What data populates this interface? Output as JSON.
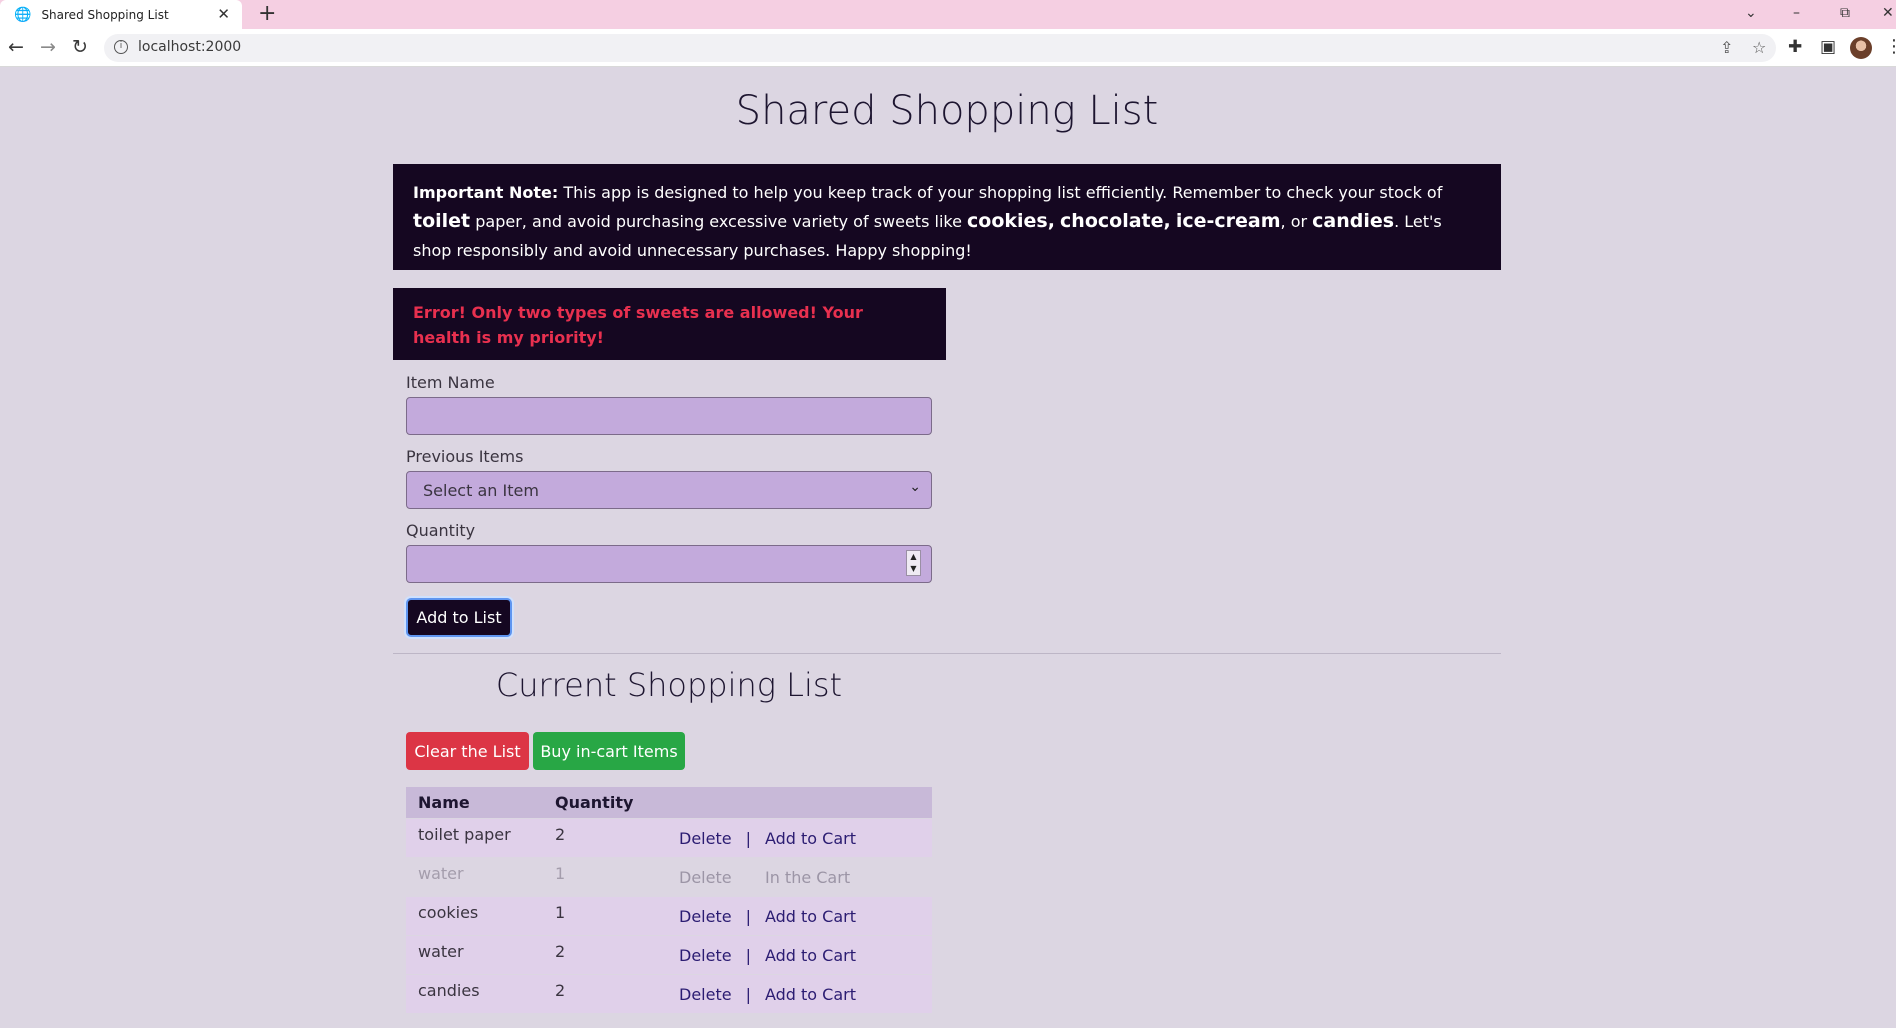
{
  "browser": {
    "tab_title": "Shared Shopping List",
    "tab_close": "✕",
    "new_tab": "+",
    "url": "localhost:2000"
  },
  "page": {
    "title": "Shared Shopping List",
    "note": {
      "lead": "Important Note:",
      "text1": " This app is designed to help you keep track of your shopping list efficiently. Remember to check your stock of ",
      "w_toilet": "toilet",
      "text2": " paper, and avoid purchasing excessive variety of sweets like ",
      "w_cookies": "cookies,",
      "w_chocolate": "chocolate,",
      "w_icecream": "ice-cream",
      "text3": ", or ",
      "w_candies": "candies",
      "text4": ". Let's shop responsibly and avoid unnecessary purchases. Happy shopping!"
    },
    "error": "Error! Only two types of sweets are allowed! Your health is my priority!",
    "form": {
      "item_name_label": "Item Name",
      "item_name_value": "",
      "previous_items_label": "Previous Items",
      "previous_items_selected": "Select an Item",
      "quantity_label": "Quantity",
      "quantity_value": "",
      "add_button": "Add to List"
    },
    "list": {
      "title": "Current Shopping List",
      "clear_button": "Clear the List",
      "buy_button": "Buy in-cart Items",
      "columns": [
        "Name",
        "Quantity"
      ],
      "separator": "|",
      "rows": [
        {
          "name": "toilet paper",
          "qty": "2",
          "delete": "Delete",
          "cart": "Add to Cart"
        },
        {
          "name": "water",
          "qty": "1",
          "delete": "Delete",
          "cart": "In the Cart"
        },
        {
          "name": "cookies",
          "qty": "1",
          "delete": "Delete",
          "cart": "Add to Cart"
        },
        {
          "name": "water",
          "qty": "2",
          "delete": "Delete",
          "cart": "Add to Cart"
        },
        {
          "name": "candies",
          "qty": "2",
          "delete": "Delete",
          "cart": "Add to Cart"
        }
      ]
    }
  }
}
